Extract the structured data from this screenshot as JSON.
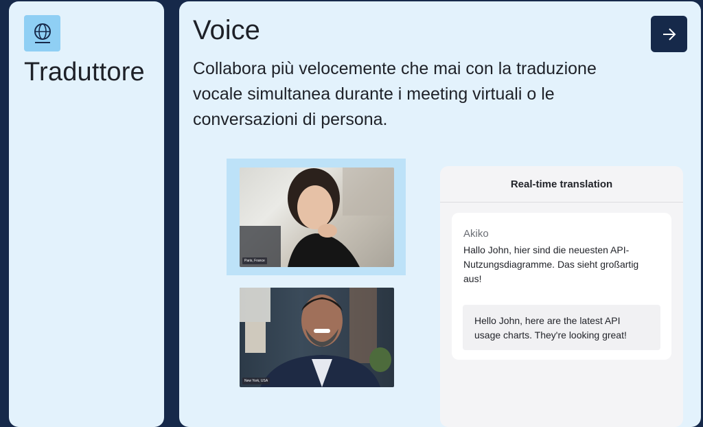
{
  "translator": {
    "title": "Traduttore",
    "icon": "globe-icon"
  },
  "voice": {
    "title": "Voice",
    "description": "Collabora più velocemente che mai con la traduzione vocale simultanea durante i meeting virtuali o le conversazioni di persona.",
    "action_icon": "arrow-right-icon"
  },
  "videos": [
    {
      "location": "Paris, France"
    },
    {
      "location": "New York, USA"
    }
  ],
  "translation_panel": {
    "header": "Real-time translation",
    "speaker": "Akiko",
    "original_text": "Hallo John, hier sind die neuesten API-Nutzungsdiagramme. Das sieht großartig aus!",
    "translated_text": "Hello John, here are the latest API usage charts. They're looking great!"
  },
  "colors": {
    "background": "#16294a",
    "card": "#e3f2fc",
    "icon_tile": "#8fcff4",
    "button": "#16294a"
  }
}
